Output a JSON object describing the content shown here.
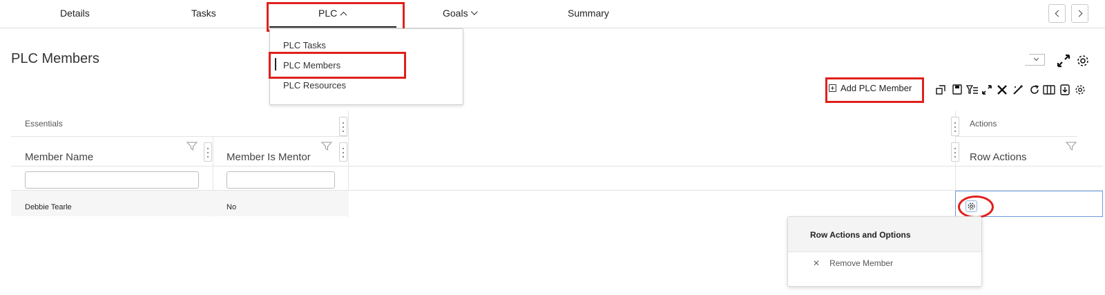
{
  "tabs": {
    "details": "Details",
    "tasks": "Tasks",
    "plc": "PLC",
    "goals": "Goals",
    "summary": "Summary"
  },
  "plc_menu": {
    "items": [
      "PLC Tasks",
      "PLC Members",
      "PLC Resources"
    ],
    "active": "PLC Members"
  },
  "page": {
    "title": "PLC Members"
  },
  "toolbar": {
    "add_label": "Add PLC Member",
    "icons": [
      "layout-icon",
      "save-icon",
      "filter-list-icon",
      "expand-icon",
      "tools-icon",
      "magic-wand-icon",
      "refresh-icon",
      "columns-icon",
      "export-icon",
      "settings-icon"
    ]
  },
  "grid": {
    "groups": {
      "essentials": "Essentials",
      "actions": "Actions"
    },
    "columns": {
      "member_name": "Member Name",
      "member_is_mentor": "Member Is Mentor",
      "row_actions": "Row Actions"
    },
    "rows": [
      {
        "member_name": "Debbie Tearle",
        "member_is_mentor": "No"
      }
    ]
  },
  "row_actions_popup": {
    "title": "Row Actions and Options",
    "items": [
      "Remove Member"
    ]
  },
  "annotation_color": "#e0201b"
}
